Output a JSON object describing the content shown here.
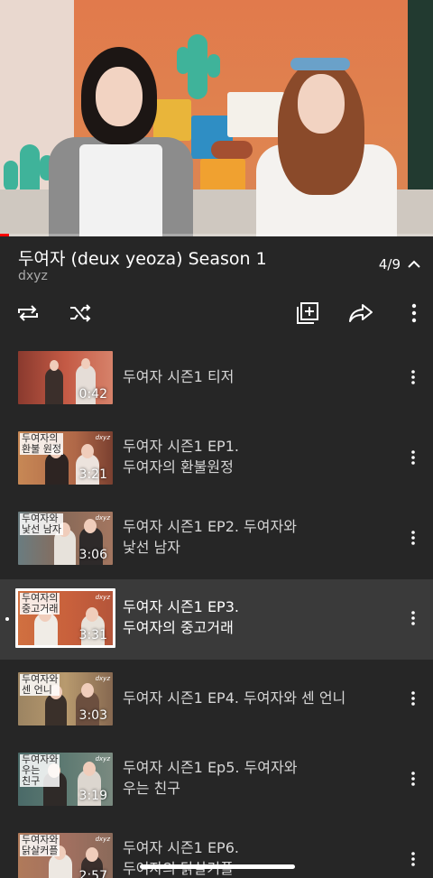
{
  "video": {
    "progress_fraction": 0.02
  },
  "playlist": {
    "title": "두여자 (deux yeoza) Season 1",
    "owner": "dxyz",
    "position": "4/9"
  },
  "thumbnail_labels": {
    "ep1": "두여자의\n환불 원정",
    "ep2": "두여자와\n낯선 남자",
    "ep3": "두여자의\n중고거래",
    "ep4": "두여자와\n센 언니",
    "ep5": "두여자와\n우는\n친구",
    "ep6": "두여자와\n닭살커플",
    "brand": "dxyz"
  },
  "items": [
    {
      "title": "두여자 시즌1 티저",
      "duration": "0:42"
    },
    {
      "title": "두여자 시즌1 EP1.\n두여자의 환불원정",
      "duration": "3:21"
    },
    {
      "title": "두여자 시즌1 EP2. 두여자와\n낯선 남자",
      "duration": "3:06"
    },
    {
      "title": "두여자 시즌1 EP3.\n두여자의 중고거래",
      "duration": "3:31"
    },
    {
      "title": "두여자 시즌1 EP4. 두여자와 센 언니",
      "duration": "3:03"
    },
    {
      "title": "두여자 시즌1 Ep5. 두여자와\n우는 친구",
      "duration": "3:19"
    },
    {
      "title": "두여자 시즌1 EP6.\n두여자의 닭살커플",
      "duration": "2:57"
    }
  ],
  "icons": {
    "loop": "loop-icon",
    "shuffle": "shuffle-icon",
    "save": "add-to-playlist-icon",
    "share": "share-icon",
    "more": "more-vertical-icon",
    "collapse": "chevron-up-icon"
  },
  "colors": {
    "background": "#262626",
    "active_row": "#3a3a3a",
    "progress": "#ff0000"
  }
}
